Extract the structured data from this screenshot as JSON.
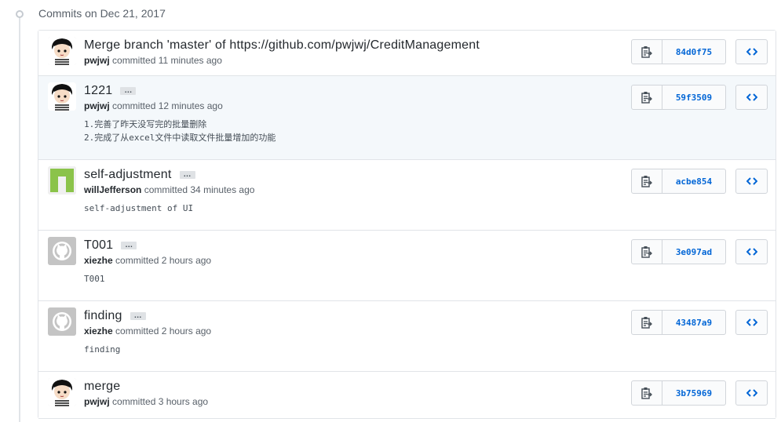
{
  "group": {
    "title": "Commits on Dec 21, 2017"
  },
  "colors": {
    "link": "#0366d6",
    "highlight_bg": "#f4f8fb"
  },
  "commits": [
    {
      "title": "Merge branch 'master' of https://github.com/pwjwj/CreditManagement",
      "has_ellipsis": false,
      "author": "pwjwj",
      "committed": "committed 11 minutes ago",
      "sha": "84d0f75",
      "description": "",
      "avatar": "cartoon-boy",
      "highlight": false
    },
    {
      "title": "1221",
      "has_ellipsis": true,
      "ellipsis_label": "…",
      "author": "pwjwj",
      "committed": "committed 12 minutes ago",
      "sha": "59f3509",
      "description": "1.完善了昨天没写完的批量删除\n2.完成了从excel文件中读取文件批量增加的功能",
      "avatar": "cartoon-boy",
      "highlight": true
    },
    {
      "title": "self-adjustment",
      "has_ellipsis": true,
      "ellipsis_label": "…",
      "author": "willJefferson",
      "committed": "committed 34 minutes ago",
      "sha": "acbe854",
      "description": "self-adjustment of UI",
      "avatar": "green-identicon",
      "highlight": false
    },
    {
      "title": "T001",
      "has_ellipsis": true,
      "ellipsis_label": "…",
      "author": "xiezhe",
      "committed": "committed 2 hours ago",
      "sha": "3e097ad",
      "description": "T001",
      "avatar": "github-default",
      "highlight": false
    },
    {
      "title": "finding",
      "has_ellipsis": true,
      "ellipsis_label": "…",
      "author": "xiezhe",
      "committed": "committed 2 hours ago",
      "sha": "43487a9",
      "description": "finding",
      "avatar": "github-default",
      "highlight": false
    },
    {
      "title": "merge",
      "has_ellipsis": false,
      "author": "pwjwj",
      "committed": "committed 3 hours ago",
      "sha": "3b75969",
      "description": "",
      "avatar": "cartoon-boy",
      "highlight": false
    }
  ]
}
